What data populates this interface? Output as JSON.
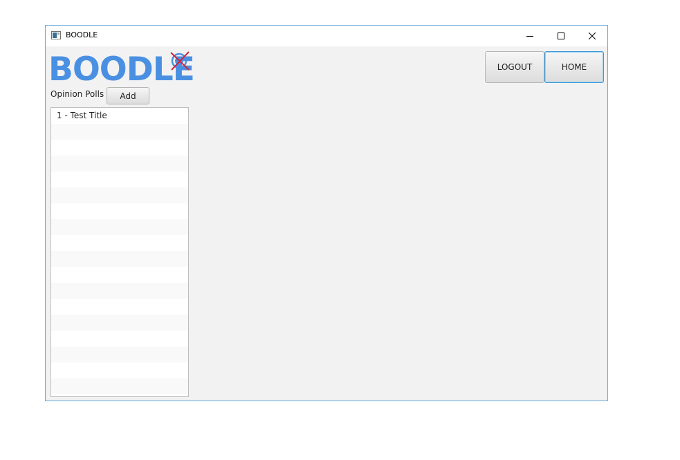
{
  "window": {
    "title": "BOODLE",
    "controls": {
      "minimize_icon": "minimize-icon",
      "maximize_icon": "maximize-icon",
      "close_icon": "close-icon"
    }
  },
  "logo": {
    "text": "BOODLE",
    "color": "#4a90e2",
    "mark_color_ring": "#4a90e2",
    "mark_color_cross": "#d0263a"
  },
  "polls": {
    "label": "Opinion Polls",
    "add_label": "Add",
    "items": [
      "1 - Test Title",
      "",
      "",
      "",
      "",
      "",
      "",
      "",
      "",
      "",
      "",
      "",
      "",
      "",
      "",
      "",
      "",
      ""
    ]
  },
  "nav": {
    "logout_label": "LOGOUT",
    "home_label": "HOME"
  }
}
